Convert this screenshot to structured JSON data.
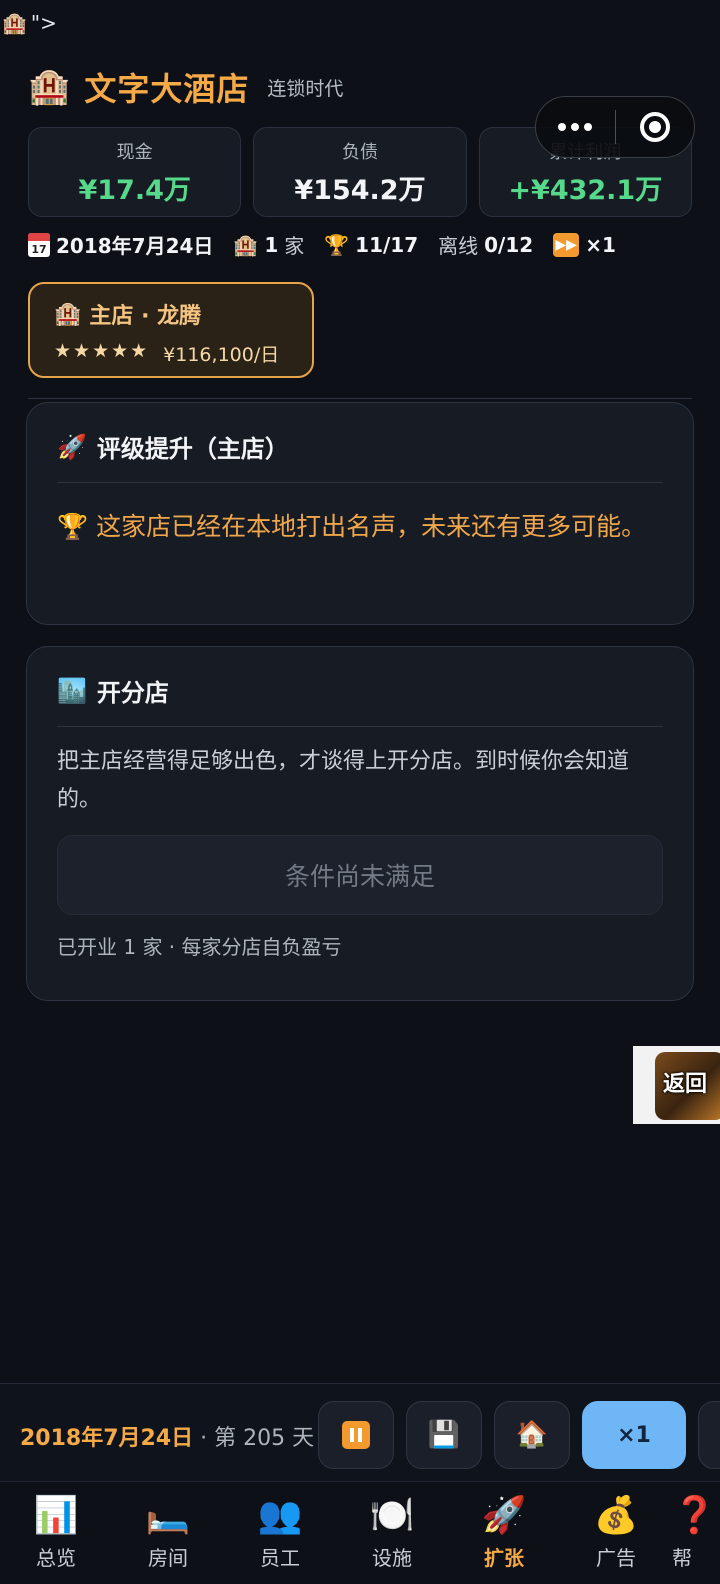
{
  "artifact": {
    "icon": "hotel-emoji",
    "text": "\">"
  },
  "header": {
    "logo_icon": "hotel-emoji",
    "title": "文字大酒店",
    "subtitle": "连锁时代"
  },
  "stats": [
    {
      "label": "现金",
      "value": "¥17.4万",
      "color": "#56d98a"
    },
    {
      "label": "负债",
      "value": "¥154.2万",
      "color": "#f2f4f7"
    },
    {
      "label": "累计利润",
      "value": "+¥432.1万",
      "color": "#56d98a"
    }
  ],
  "info": {
    "date": "2018年7月24日",
    "hotels_count": "1",
    "hotels_unit": "家",
    "trophy": "11/17",
    "offline_label": "离线",
    "offline_value": "0/12",
    "speed": "×1"
  },
  "hotel_chip": {
    "name": "主店 · 龙腾",
    "stars": "★★★★★",
    "income": "¥116,100/日"
  },
  "rating_card": {
    "title": "评级提升（主店）",
    "body": "🏆 这家店已经在本地打出名声，未来还有更多可能。"
  },
  "branch_card": {
    "title": "开分店",
    "body": "把主店经营得足够出色，才谈得上开分店。到时候你会知道的。",
    "button": "条件尚未满足",
    "footer": "已开业 1 家 · 每家分店自负盈亏"
  },
  "float_back": {
    "label": "返回"
  },
  "bottombar": {
    "date": "2018年7月24日",
    "day_text": "· 第 205 天",
    "speed_label": "×1"
  },
  "tabs": [
    {
      "label": "总览",
      "icon": "bar-chart-icon",
      "active": false
    },
    {
      "label": "房间",
      "icon": "bed-icon",
      "active": false
    },
    {
      "label": "员工",
      "icon": "people-icon",
      "active": false
    },
    {
      "label": "设施",
      "icon": "plate-icon",
      "active": false
    },
    {
      "label": "扩张",
      "icon": "rocket-icon",
      "active": true
    },
    {
      "label": "广告",
      "icon": "money-bag-icon",
      "active": false
    },
    {
      "label": "帮",
      "icon": "help-icon",
      "active": false
    }
  ]
}
